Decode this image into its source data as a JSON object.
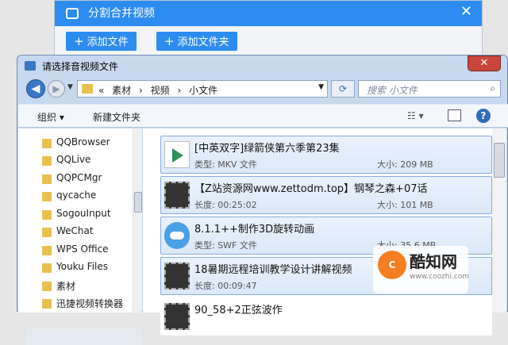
{
  "bg_app": {
    "title": "分割合并视频",
    "close": "✕",
    "add_file": "添加文件",
    "add_folder": "添加文件夹",
    "plus": "+"
  },
  "dialog": {
    "title": "请选择音视频文件",
    "close": "✕",
    "breadcrumb": [
      "«",
      "素材",
      "›",
      "视频",
      "›",
      "小文件"
    ],
    "search_placeholder": "搜索 小文件",
    "toolbar": {
      "organize": "组织 ▾",
      "new_folder": "新建文件夹",
      "help": "?"
    }
  },
  "sidebar_items": [
    "QQBrowser",
    "QQLive",
    "QQPCMgr",
    "qycache",
    "SogouInput",
    "WeChat",
    "WPS Office",
    "Youku Files",
    "素材",
    "迅捷视频转换器"
  ],
  "files": [
    {
      "name": "[中英双字]绿箭侠第六季第23集",
      "meta_label": "类型: MKV 文件",
      "size_label": "大小: 209 MB",
      "icon": "mkv-icon"
    },
    {
      "name": "【Z站资源网www.zettodm.top】钢琴之森+07话",
      "meta_label": "长度: 00:25:02",
      "size_label": "大小: 101 MB",
      "icon": "film-icon"
    },
    {
      "name": "8.1.1++制作3D旋转动画",
      "meta_label": "类型: SWF 文件",
      "size_label": "大小: 35.6 MB",
      "icon": "swf-icon"
    },
    {
      "name": "18暑期远程培训教学设计讲解视频",
      "meta_label": "长度: 00:09:47",
      "size_label": "",
      "icon": "film-icon"
    },
    {
      "name": "90_58+2正弦波作",
      "meta_label": "",
      "size_label": "",
      "icon": "film-icon"
    }
  ],
  "watermark": {
    "brand": "酷知网",
    "url": "www.coozhi.com",
    "glyph": "C"
  }
}
